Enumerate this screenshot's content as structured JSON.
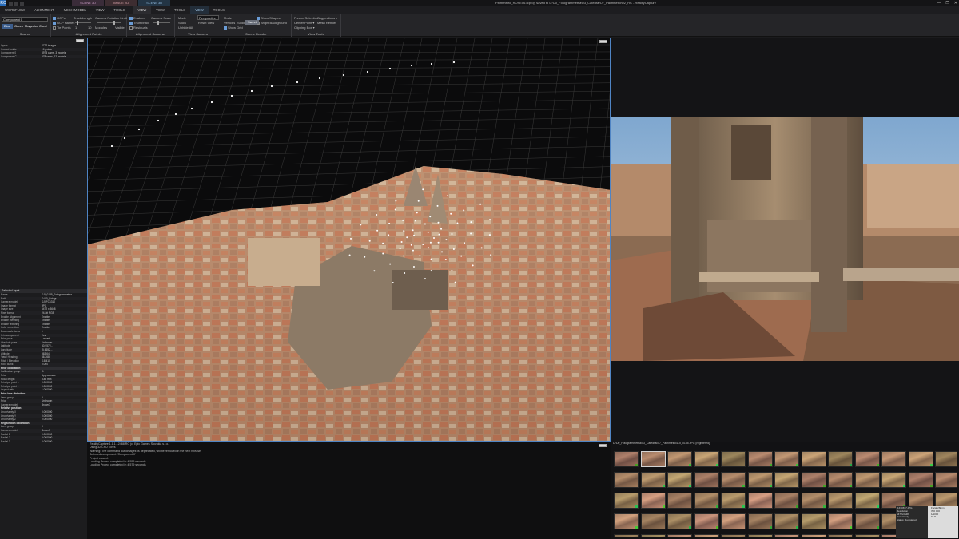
{
  "titlebar": {
    "logo": "RC",
    "ctx_tabs": [
      "SCENE 3D",
      "IMAGE 2D",
      "SCENE 3D"
    ],
    "window_title": "Palmmetro_ROSE06.rcproj* saved to D:\\00_Fotogrammetria\\03_Catedral\\07_Palmmetro\\02_RC - RealityCapture",
    "controls": [
      "—",
      "❐",
      "✕"
    ]
  },
  "menubar": {
    "items": [
      "WORKFLOW",
      "ALIGNMENT",
      "MESH MODEL",
      "VIEW",
      "TOOLS",
      "VIEW",
      "VIEW",
      "TOOLS",
      "VIEW",
      "TOOLS"
    ]
  },
  "ribbon": {
    "source": {
      "label": "Source",
      "component_label": "Component 0",
      "colors": [
        "Blue",
        "Green",
        "Magenta",
        "Coral"
      ],
      "checks": [
        "GCPs",
        "GCP Names",
        "Tie Points"
      ]
    },
    "alignment_points": {
      "label": "Alignment Points",
      "track_length": "Track Length",
      "rotation": "Camera Rotation Limit",
      "ticks": [
        "1",
        "10",
        "Modules",
        "Visible"
      ]
    },
    "alignment_cameras": {
      "label": "Alignment Cameras",
      "checks": [
        "Enabled",
        "Thumbnail",
        "Residuals"
      ],
      "camera_scale": "Camera Scale"
    },
    "view_camera": {
      "label": "View Camera",
      "items": [
        "Mode",
        "Show",
        "Unhide All"
      ],
      "projection": "Perspective",
      "reset": "Reset View"
    },
    "scene_render": {
      "label": "Scene Render",
      "mode_label": "Mode",
      "modes": [
        "Vertices",
        "Solid",
        "Sweet"
      ],
      "checks": [
        "Show Shapes",
        "Bright Background",
        "Show Grid"
      ]
    },
    "view_tools": {
      "label": "View Tools",
      "items": [
        "Freeze Selection ▾",
        "Center Point ▾",
        "Clipping Box ▾"
      ],
      "sugg": "Suggestions ▾",
      "mesh": "Mesh Render"
    }
  },
  "left": {
    "top_rows": [
      [
        "Inputs",
        "4772 images"
      ],
      [
        "Control points",
        "16 points"
      ],
      [
        "Component 0",
        "4973 cams, 3 models"
      ],
      [
        "Component C",
        "978 cams, 12 models"
      ]
    ],
    "panel_title": "Selected Input",
    "rows": [
      [
        "Name",
        "DJI_0185_Fotogrammetria"
      ],
      [
        "Path",
        "D:\\00_Fotogr..."
      ],
      [
        "Camera model",
        "DJI FC6310"
      ],
      [
        "Image format",
        "JPG"
      ],
      [
        "Image size",
        "5472 x 3648"
      ],
      [
        "Pixel format",
        "24-bit RGB"
      ],
      [
        "Enable alignment",
        "Enable"
      ],
      [
        "Enable meshing",
        "Enable"
      ],
      [
        "Enable texturing",
        "Enable"
      ],
      [
        "Color correction",
        "Enable"
      ],
      [
        "Downscale factor",
        "1"
      ],
      [
        "Is in component",
        "Yes"
      ],
      [
        "Prior pose",
        "Locked"
      ],
      [
        "Absolute pose",
        "Unknown"
      ],
      [
        "Latitude",
        "40.9572..."
      ],
      [
        "Longitude",
        "-5.6652..."
      ],
      [
        "Altitude",
        "863.64"
      ],
      [
        "Yaw / Heading",
        "46.268"
      ],
      [
        "Pitch / Elevation",
        "-18.410"
      ],
      [
        "Roll / Bank",
        "0.000"
      ],
      [
        "Prior calibration",
        ""
      ],
      [
        "Calibration group",
        "-1"
      ],
      [
        "Prior",
        "Approximate"
      ],
      [
        "Focal length",
        "8.80 mm"
      ],
      [
        "Principal point x",
        "0.000000"
      ],
      [
        "Principal point y",
        "0.000000"
      ],
      [
        "Aspect ratio",
        "1.000000"
      ],
      [
        "Prior lens distortion",
        ""
      ],
      [
        "Lens group",
        "0"
      ],
      [
        "Prior",
        "Unknown"
      ],
      [
        "Camera model",
        "Brown3"
      ],
      [
        "Relative position",
        ""
      ],
      [
        "Uncertainty X",
        "0.000000"
      ],
      [
        "Uncertainty Y",
        "0.000000"
      ],
      [
        "Uncertainty Z",
        "0.000000"
      ],
      [
        "Registration calibration",
        ""
      ],
      [
        "Lens group",
        "0"
      ],
      [
        "Camera model",
        "Brown3"
      ],
      [
        "Radial 1",
        "0.000000"
      ],
      [
        "Radial 2",
        "0.000000"
      ],
      [
        "Radial 3",
        "0.000000"
      ]
    ]
  },
  "console": {
    "lines": [
      "RealityCapture 1.1.1.12488 RC (c) Epic Games Slovakia s.r.o.",
      "Using 32 CPU cores",
      "Warning: The command 'loadImages' is deprecated, will be removed in the next release.",
      "Selected component: 'Component 0'",
      "Project closed.",
      "Loading Project completed in 4.555 seconds",
      "Loading Project completed in 4.579 seconds"
    ]
  },
  "image_panel": {
    "caption": "D:\\00_Fotogrammetria\\03_Catedral\\07_Palmmetro\\DJI_0185.JPG [registered]"
  },
  "tooltip": {
    "left": [
      "DJI_0677.JPG",
      "Resolution",
      "5472x3648",
      "Uncertainty",
      "Status: Registered"
    ],
    "right": [
      "Focal 28mm",
      "ISO 100",
      "1/1000",
      "f/2.8"
    ]
  },
  "colors": {
    "accent": "#4f84c4",
    "selected_flag": "#39c23f"
  }
}
